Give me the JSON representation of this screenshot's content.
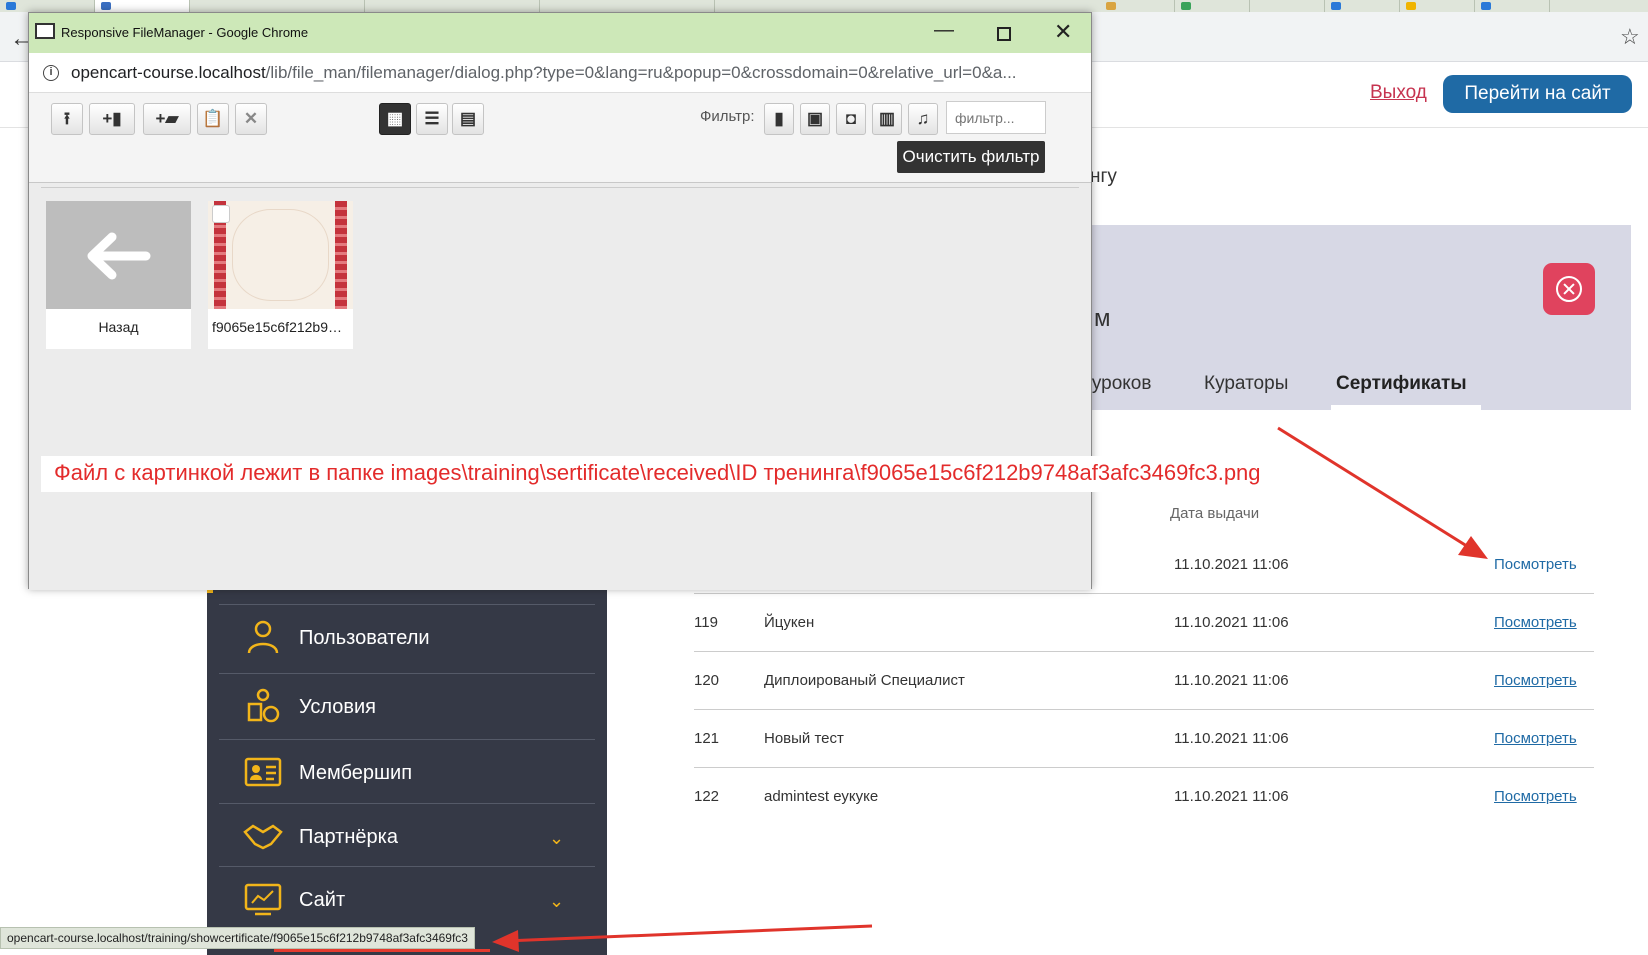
{
  "browser": {
    "back_glyph": "←",
    "star_glyph": "☆"
  },
  "site": {
    "logout_label": "Выход",
    "go_site_label": "Перейти на сайт",
    "partial_text_top": "нгу",
    "card_title_partial": "м",
    "tabs": [
      {
        "label": "е уроков"
      },
      {
        "label": "Кураторы"
      },
      {
        "label": "Сертификаты"
      }
    ],
    "date_column_header": "Дата выдачи",
    "rows": [
      {
        "id": "",
        "name": "",
        "date": "11.10.2021 11:06",
        "view": "Посмотреть"
      },
      {
        "id": "119",
        "name": "Йцукен",
        "date": "11.10.2021 11:06",
        "view": "Посмотреть"
      },
      {
        "id": "120",
        "name": "Диплоированый Специалист",
        "date": "11.10.2021 11:06",
        "view": "Посмотреть"
      },
      {
        "id": "121",
        "name": "Новый тест",
        "date": "11.10.2021 11:06",
        "view": "Посмотреть"
      },
      {
        "id": "122",
        "name": "admintest еукуке",
        "date": "11.10.2021 11:06",
        "view": "Посмотреть"
      }
    ],
    "side_menu": [
      {
        "label": "Пользователи",
        "icon": "user-icon"
      },
      {
        "label": "Условия",
        "icon": "conditions-icon"
      },
      {
        "label": "Мембершип",
        "icon": "id-card-icon"
      },
      {
        "label": "Партнёрка",
        "icon": "handshake-icon",
        "has_chevron": true
      },
      {
        "label": "Сайт",
        "icon": "monitor-icon",
        "has_chevron": true
      }
    ],
    "chevron_glyph": "⌄"
  },
  "status_bar": {
    "url": "opencart-course.localhost/training/showcertificate/f9065e15c6f212b9748af3afc3469fc3"
  },
  "file_manager": {
    "window_title": "Responsive FileManager - Google Chrome",
    "minimize_glyph": "—",
    "close_glyph": "✕",
    "url_host": "opencart-course.localhost",
    "url_path": "/lib/file_man/filemanager/dialog.php?type=0&lang=ru&popup=0&crossdomain=0&relative_url=0&a...",
    "toolbar": {
      "upload_glyph": "⭱",
      "new_file_glyph": "+▮",
      "new_folder_glyph": "+▰",
      "paste_glyph": "📋",
      "clear_clipboard_glyph": "✕",
      "view_grid_glyph": "▦",
      "view_list_glyph": "☰",
      "view_columns_glyph": "▤",
      "filter_label": "Фильтр:",
      "filter_file_glyph": "▮",
      "filter_image_glyph": "▣",
      "filter_archive_glyph": "◘",
      "filter_video_glyph": "▥",
      "filter_audio_glyph": "♫",
      "filter_placeholder": "фильтр...",
      "clear_filter_label": "Очистить фильтр"
    },
    "items": [
      {
        "caption": "Назад",
        "arrow_glyph": "←"
      },
      {
        "caption": "f9065e15c6f212b9748af3afc3469fc3.png"
      }
    ]
  },
  "annotation": {
    "text": "Файл с картинкой лежит в папке images\\training\\sertificate\\received\\ID тренинга\\f9065e15c6f212b9748af3afc3469fc3.png"
  },
  "colors": {
    "accent_blue": "#1f6aa5",
    "logout_red": "#c6334f",
    "close_pink": "#e0435e",
    "menu_dark": "#353946",
    "menu_icon_gold": "#f2b51a",
    "annotation_red": "#e32b2b",
    "fm_titlebar": "#cde8b8"
  }
}
